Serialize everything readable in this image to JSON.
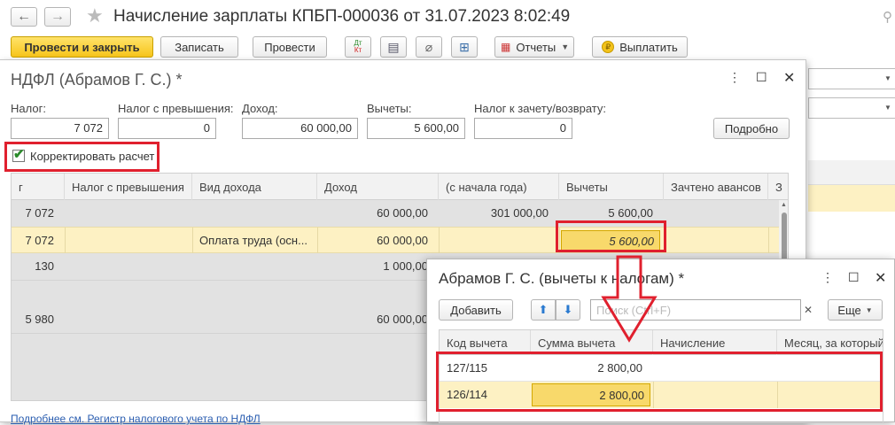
{
  "main": {
    "title": "Начисление зарплаты КПБП-000036 от 31.07.2023 8:02:49",
    "toolbar": {
      "post_close": "Провести и закрыть",
      "save": "Записать",
      "post": "Провести",
      "dtkt_top": "Дт",
      "dtkt_bottom": "Кт",
      "reports": "Отчеты",
      "pay": "Выплатить"
    }
  },
  "ndfl": {
    "title": "НДФЛ (Абрамов Г. С.) *",
    "labels": {
      "tax": "Налог:",
      "tax_excess": "Налог с превышения:",
      "income": "Доход:",
      "deductions": "Вычеты:",
      "offset": "Налог к зачету/возврату:"
    },
    "values": {
      "tax": "7 072",
      "tax_excess": "0",
      "income": "60 000,00",
      "deductions": "5 600,00",
      "offset": "0"
    },
    "details_button": "Подробно",
    "correct_checkbox": "Корректировать расчет",
    "correct_checked": true,
    "columns": [
      "г",
      "Налог с превышения",
      "Вид дохода",
      "Доход",
      "(с начала года)",
      "Вычеты",
      "Зачтено авансов",
      "З"
    ],
    "rows": [
      [
        "7 072",
        "",
        "",
        "60 000,00",
        "301 000,00",
        "5 600,00",
        ""
      ],
      [
        "7 072",
        "",
        "Оплата труда (осн...",
        "60 000,00",
        "",
        "5 600,00",
        ""
      ],
      [
        "130",
        "",
        "",
        "1 000,00",
        "",
        "",
        ""
      ],
      [
        "",
        "",
        "",
        "",
        "",
        "",
        ""
      ],
      [
        "5 980",
        "",
        "",
        "60 000,00",
        "",
        "",
        ""
      ]
    ],
    "footer_link": "Подробнее см. Регистр налогового учета по НДФЛ"
  },
  "deductions_window": {
    "title": "Абрамов Г. С. (вычеты к налогам) *",
    "add_button": "Добавить",
    "search_placeholder": "Поиск (Ctrl+F)",
    "more_button": "Еще",
    "columns": [
      "Код вычета",
      "Сумма вычета",
      "Начисление",
      "Месяц, за который"
    ],
    "rows": [
      [
        "127/115",
        "2 800,00",
        "",
        ""
      ],
      [
        "126/114",
        "2 800,00",
        "",
        ""
      ]
    ]
  },
  "colors": {
    "highlight_red": "#e0202e",
    "selected_row": "#fdf1c3",
    "accent_yellow": "#f7c51b"
  }
}
